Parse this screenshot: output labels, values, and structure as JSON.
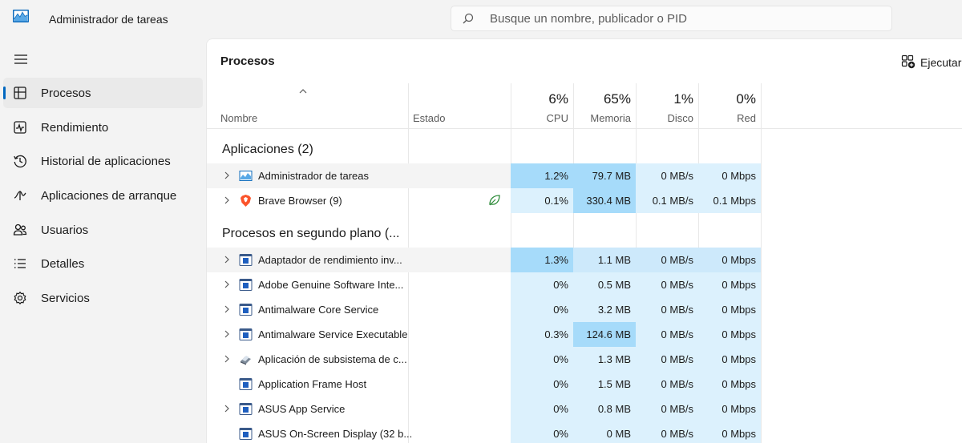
{
  "app": {
    "title": "Administrador de tareas",
    "search_placeholder": "Busque un nombre, publicador o PID"
  },
  "sidebar": {
    "items": [
      {
        "label": "Procesos",
        "icon": "processes-icon",
        "active": true
      },
      {
        "label": "Rendimiento",
        "icon": "performance-icon"
      },
      {
        "label": "Historial de aplicaciones",
        "icon": "history-icon"
      },
      {
        "label": "Aplicaciones de arranque",
        "icon": "startup-icon"
      },
      {
        "label": "Usuarios",
        "icon": "users-icon"
      },
      {
        "label": "Detalles",
        "icon": "details-icon"
      },
      {
        "label": "Servicios",
        "icon": "services-icon"
      }
    ]
  },
  "main": {
    "title": "Procesos",
    "run_label": "Ejecutar"
  },
  "table": {
    "headers": {
      "name": "Nombre",
      "state": "Estado",
      "cpu_pct": "6%",
      "cpu": "CPU",
      "mem_pct": "65%",
      "mem": "Memoria",
      "disk_pct": "1%",
      "disk": "Disco",
      "net_pct": "0%",
      "net": "Red"
    },
    "groups": [
      {
        "label": "Aplicaciones (2)",
        "rows": [
          {
            "name": "Administrador de tareas",
            "icon": "taskmgr-icon",
            "expand": true,
            "cpu": "1.2%",
            "mem": "79.7 MB",
            "disk": "0 MB/s",
            "net": "0 Mbps",
            "heat": [
              2,
              2,
              0,
              0
            ],
            "hl": true
          },
          {
            "name": "Brave Browser (9)",
            "icon": "brave-icon",
            "expand": true,
            "eco": true,
            "cpu": "0.1%",
            "mem": "330.4 MB",
            "disk": "0.1 MB/s",
            "net": "0.1 Mbps",
            "heat": [
              0,
              2,
              0,
              0
            ]
          }
        ]
      },
      {
        "label": "Procesos en segundo plano (...",
        "rows": [
          {
            "name": "Adaptador de rendimiento inv...",
            "icon": "app-window-icon",
            "expand": true,
            "cpu": "1.3%",
            "mem": "1.1 MB",
            "disk": "0 MB/s",
            "net": "0 Mbps",
            "heat": [
              2,
              1,
              1,
              1
            ],
            "hl": true
          },
          {
            "name": "Adobe Genuine Software Inte...",
            "icon": "app-window-icon",
            "expand": true,
            "cpu": "0%",
            "mem": "0.5 MB",
            "disk": "0 MB/s",
            "net": "0 Mbps",
            "heat": [
              0,
              0,
              0,
              0
            ]
          },
          {
            "name": "Antimalware Core Service",
            "icon": "app-window-icon",
            "expand": true,
            "cpu": "0%",
            "mem": "3.2 MB",
            "disk": "0 MB/s",
            "net": "0 Mbps",
            "heat": [
              0,
              0,
              0,
              0
            ]
          },
          {
            "name": "Antimalware Service Executable",
            "icon": "app-window-icon",
            "expand": true,
            "cpu": "0.3%",
            "mem": "124.6 MB",
            "disk": "0 MB/s",
            "net": "0 Mbps",
            "heat": [
              0,
              2,
              0,
              0
            ]
          },
          {
            "name": "Aplicación de subsistema de c...",
            "icon": "print-spooler-icon",
            "expand": true,
            "cpu": "0%",
            "mem": "1.3 MB",
            "disk": "0 MB/s",
            "net": "0 Mbps",
            "heat": [
              0,
              0,
              0,
              0
            ]
          },
          {
            "name": "Application Frame Host",
            "icon": "app-window-icon",
            "expand": false,
            "cpu": "0%",
            "mem": "1.5 MB",
            "disk": "0 MB/s",
            "net": "0 Mbps",
            "heat": [
              0,
              0,
              0,
              0
            ]
          },
          {
            "name": "ASUS App Service",
            "icon": "app-window-icon",
            "expand": true,
            "cpu": "0%",
            "mem": "0.8 MB",
            "disk": "0 MB/s",
            "net": "0 Mbps",
            "heat": [
              0,
              0,
              0,
              0
            ]
          },
          {
            "name": "ASUS On-Screen Display (32 b...",
            "icon": "app-window-icon",
            "expand": false,
            "cpu": "0%",
            "mem": "0 MB",
            "disk": "0 MB/s",
            "net": "0 Mbps",
            "heat": [
              0,
              0,
              0,
              0
            ]
          }
        ]
      }
    ]
  },
  "colors": {
    "heat0": "#dcf1fd",
    "heat1": "#cde9fb",
    "heat2": "#a6dbfa",
    "accent": "#0067c0"
  }
}
